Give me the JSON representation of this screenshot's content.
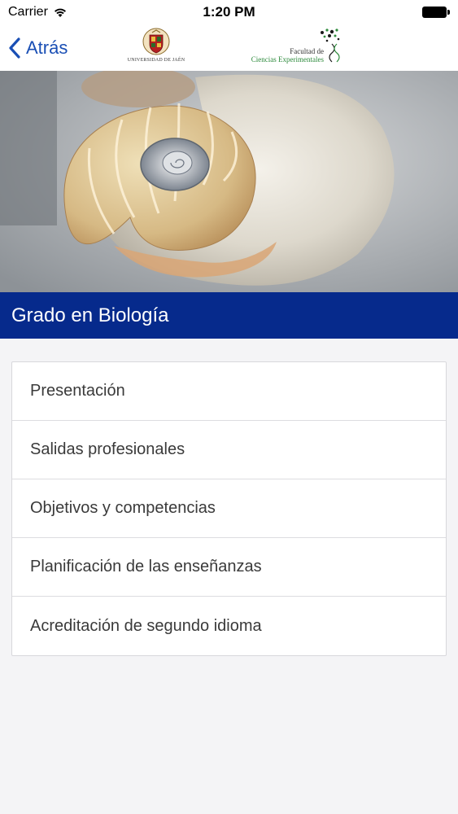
{
  "status_bar": {
    "carrier": "Carrier",
    "time": "1:20 PM"
  },
  "nav": {
    "back_label": "Atrás",
    "logo_uja_text": "UNIVERSIDAD DE JAÉN",
    "logo_ciencias_line1": "Facultad de",
    "logo_ciencias_line2": "Ciencias Experimentales"
  },
  "hero": {
    "icon": "nautilus-shell-photo"
  },
  "section": {
    "title": "Grado en Biología"
  },
  "menu": {
    "items": [
      {
        "label": "Presentación"
      },
      {
        "label": "Salidas profesionales"
      },
      {
        "label": "Objetivos y competencias"
      },
      {
        "label": "Planificación de las enseñanzas"
      },
      {
        "label": "Acreditación de segundo idioma"
      }
    ]
  },
  "colors": {
    "header_blue": "#062a8c",
    "link_blue": "#1a4fb5"
  }
}
